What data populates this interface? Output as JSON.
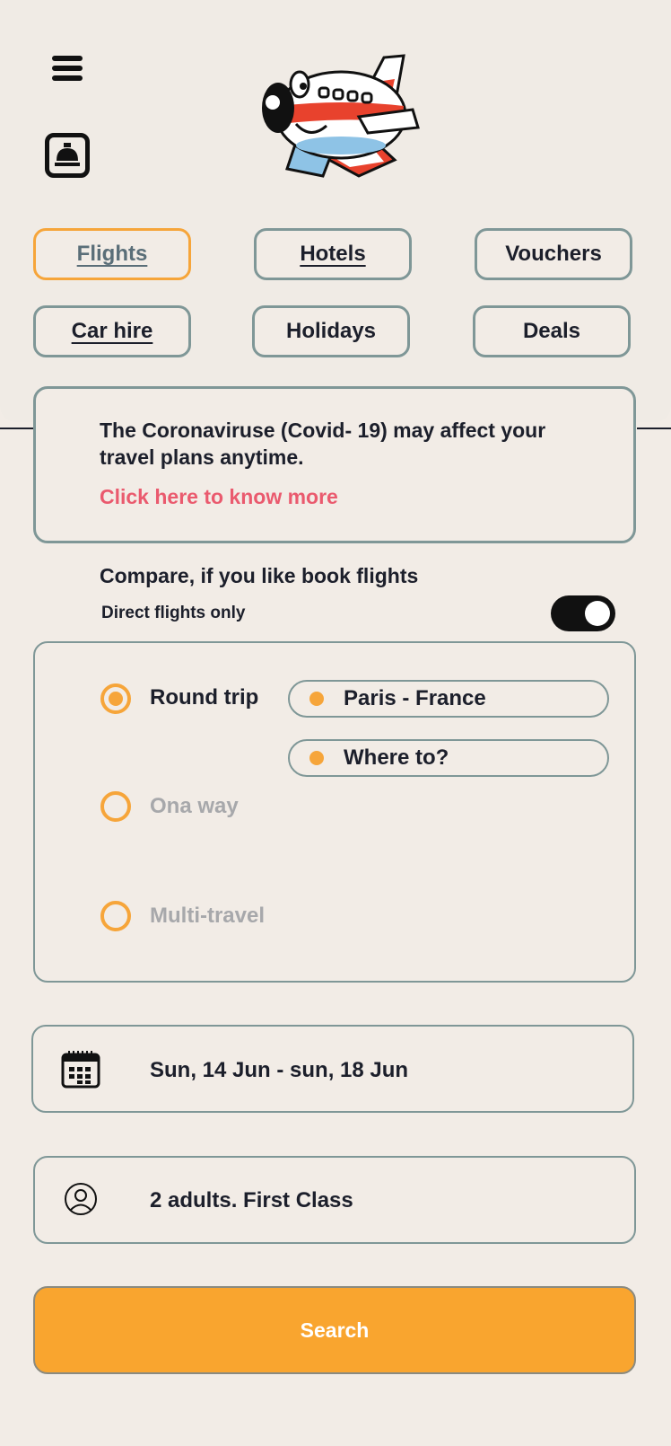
{
  "header": {
    "menu_icon": "menu-icon",
    "bell_icon": "service-bell-icon",
    "logo": "cartoon-airplane-logo"
  },
  "tabs": [
    {
      "label": "Flights",
      "active": true
    },
    {
      "label": "Hotels",
      "active": false
    },
    {
      "label": "Vouchers",
      "active": false
    },
    {
      "label": "Car hire",
      "active": false
    },
    {
      "label": "Holidays",
      "active": false
    },
    {
      "label": "Deals",
      "active": false
    }
  ],
  "notice": {
    "text": "The Coronaviruse (Covid- 19) may affect your travel plans anytime.",
    "link": "Click here to know more"
  },
  "compare": {
    "title": "Compare, if you like book flights",
    "direct_label": "Direct flights only",
    "direct_enabled": true
  },
  "trip": {
    "options": [
      {
        "label": "Round trip",
        "selected": true
      },
      {
        "label": "Ona way",
        "selected": false
      },
      {
        "label": "Multi-travel",
        "selected": false
      }
    ],
    "from": "Paris - France",
    "to": "Where to?"
  },
  "dates": {
    "value": "Sun, 14 Jun - sun, 18 Jun",
    "icon": "calendar-icon"
  },
  "passengers": {
    "value": "2 adults. First Class",
    "icon": "user-icon"
  },
  "search_label": "Search",
  "colors": {
    "accent": "#f6a53a",
    "border": "#7f9797",
    "background": "#f2ece6",
    "link": "#ea5a6e",
    "text": "#1c1f2b"
  }
}
